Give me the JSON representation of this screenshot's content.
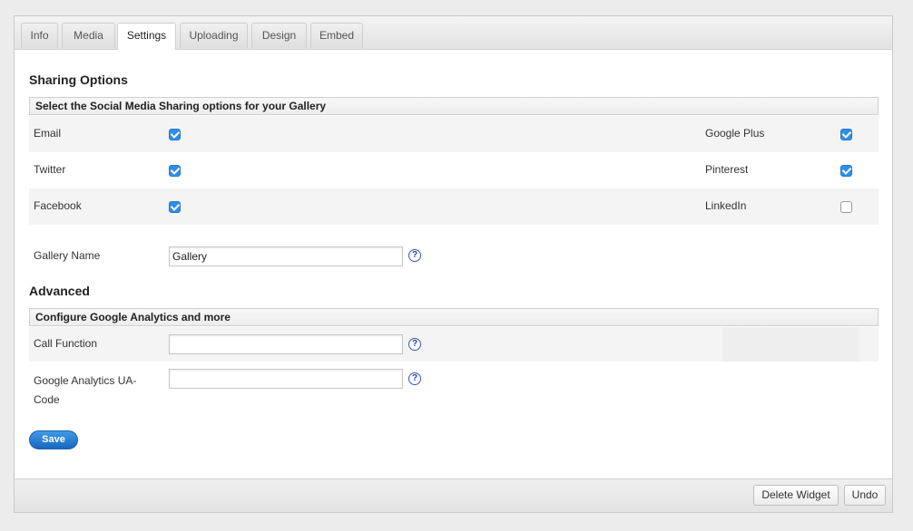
{
  "tabs": [
    "Info",
    "Media",
    "Settings",
    "Uploading",
    "Design",
    "Embed"
  ],
  "active_tab": "Settings",
  "sharing": {
    "title": "Sharing Options",
    "bar_label": "Select the Social Media Sharing options for your Gallery",
    "left": [
      {
        "label": "Email",
        "checked": true
      },
      {
        "label": "Twitter",
        "checked": true
      },
      {
        "label": "Facebook",
        "checked": true
      }
    ],
    "right": [
      {
        "label": "Google Plus",
        "checked": true
      },
      {
        "label": "Pinterest",
        "checked": true
      },
      {
        "label": "LinkedIn",
        "checked": false
      }
    ]
  },
  "gallery_name": {
    "label": "Gallery Name",
    "value": "Gallery"
  },
  "advanced": {
    "title": "Advanced",
    "bar_label": "Configure Google Analytics and more",
    "call_function": {
      "label": "Call Function",
      "value": ""
    },
    "ua_code": {
      "label_line1": "Google Analytics UA-",
      "label_line2": "Code",
      "value": ""
    }
  },
  "help_glyph": "?",
  "save_label": "Save",
  "footer": {
    "delete_label": "Delete Widget",
    "undo_label": "Undo"
  },
  "colors": {
    "checkbox_on": "#2f8ee9",
    "save_button": "#1a66c2"
  }
}
